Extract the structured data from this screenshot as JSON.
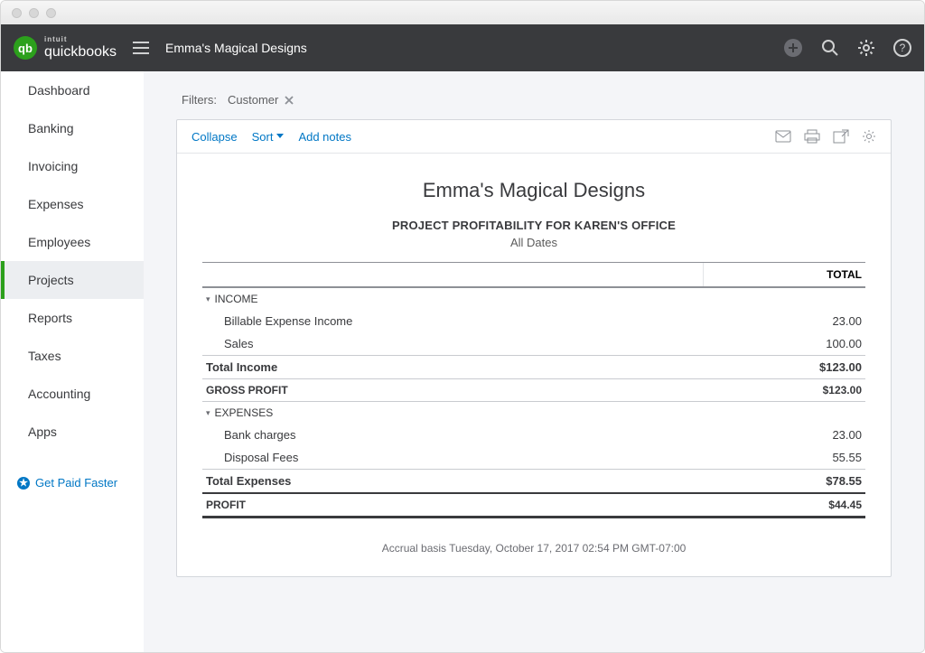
{
  "brand": {
    "intuit": "intuit",
    "product": "quickbooks",
    "badge": "qb"
  },
  "header": {
    "company": "Emma's Magical Designs"
  },
  "sidebar": {
    "items": [
      {
        "label": "Dashboard"
      },
      {
        "label": "Banking"
      },
      {
        "label": "Invoicing"
      },
      {
        "label": "Expenses"
      },
      {
        "label": "Employees"
      },
      {
        "label": "Projects"
      },
      {
        "label": "Reports"
      },
      {
        "label": "Taxes"
      },
      {
        "label": "Accounting"
      },
      {
        "label": "Apps"
      }
    ],
    "active_index": 5,
    "cta": "Get Paid Faster"
  },
  "filters": {
    "label": "Filters:",
    "chip": "Customer"
  },
  "toolbar": {
    "collapse": "Collapse",
    "sort": "Sort",
    "add_notes": "Add notes"
  },
  "report": {
    "company": "Emma's Magical Designs",
    "title": "PROJECT PROFITABILITY FOR KAREN'S OFFICE",
    "date_range": "All Dates",
    "columns": {
      "total": "TOTAL"
    },
    "sections": {
      "income": {
        "heading": "INCOME",
        "rows": [
          {
            "label": "Billable Expense Income",
            "value": "23.00"
          },
          {
            "label": "Sales",
            "value": "100.00"
          }
        ],
        "total": {
          "label": "Total Income",
          "value": "$123.00"
        }
      },
      "gross_profit": {
        "label": "GROSS PROFIT",
        "value": "$123.00"
      },
      "expenses": {
        "heading": "EXPENSES",
        "rows": [
          {
            "label": "Bank charges",
            "value": "23.00"
          },
          {
            "label": "Disposal Fees",
            "value": "55.55"
          }
        ],
        "total": {
          "label": "Total Expenses",
          "value": "$78.55"
        }
      },
      "profit": {
        "label": "PROFIT",
        "value": "$44.45"
      }
    },
    "footer": "Accrual basis   Tuesday, October 17, 2017   02:54 PM GMT-07:00"
  }
}
